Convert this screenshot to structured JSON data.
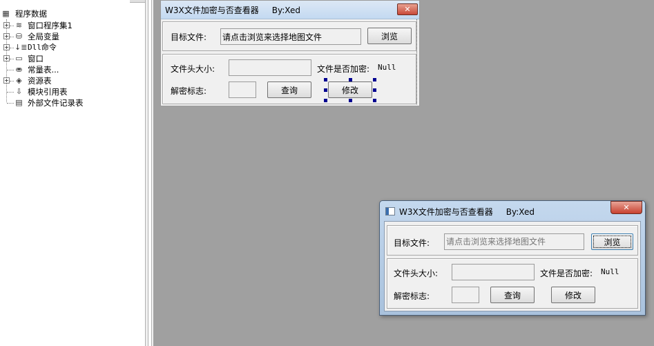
{
  "tree": {
    "root": "程序数据",
    "items": [
      {
        "label": "窗口程序集1",
        "icon": "layers-icon",
        "expander": "+"
      },
      {
        "label": "全局变量",
        "icon": "cylinder-icon",
        "expander": "+"
      },
      {
        "label": "Dll命令",
        "icon": "dll-command-icon",
        "expander": "+"
      },
      {
        "label": "窗口",
        "icon": "window-icon",
        "expander": "+"
      },
      {
        "label": "常量表...",
        "icon": "constant-table-icon",
        "expander": ""
      },
      {
        "label": "资源表",
        "icon": "resource-icon",
        "expander": "+"
      },
      {
        "label": "模块引用表",
        "icon": "module-reference-icon",
        "expander": ""
      },
      {
        "label": "外部文件记录表",
        "icon": "file-record-icon",
        "expander": ""
      }
    ]
  },
  "designer_window": {
    "title": "W3X文件加密与否查看器     By:Xed",
    "close": "✕",
    "target_label": "目标文件:",
    "target_value": "请点击浏览来选择地图文件",
    "browse": "浏览",
    "header_size_label": "文件头大小:",
    "encrypted_label": "文件是否加密:",
    "encrypted_value": "Null",
    "decrypt_flag_label": "解密标志:",
    "query": "查询",
    "modify": "修改"
  },
  "preview_window": {
    "title": "W3X文件加密与否查看器     By:Xed",
    "close": "✕",
    "target_label": "目标文件:",
    "target_placeholder": "请点击浏览来选择地图文件",
    "browse": "浏览",
    "header_size_label": "文件头大小:",
    "encrypted_label": "文件是否加密:",
    "encrypted_value": "Null",
    "decrypt_flag_label": "解密标志:",
    "query": "查询",
    "modify": "修改"
  },
  "colors": {
    "workspace": "#a0a0a0",
    "selection_handle": "#000090",
    "close_button": "#c84a3a",
    "titlebar_active": "#c3d9f1"
  }
}
